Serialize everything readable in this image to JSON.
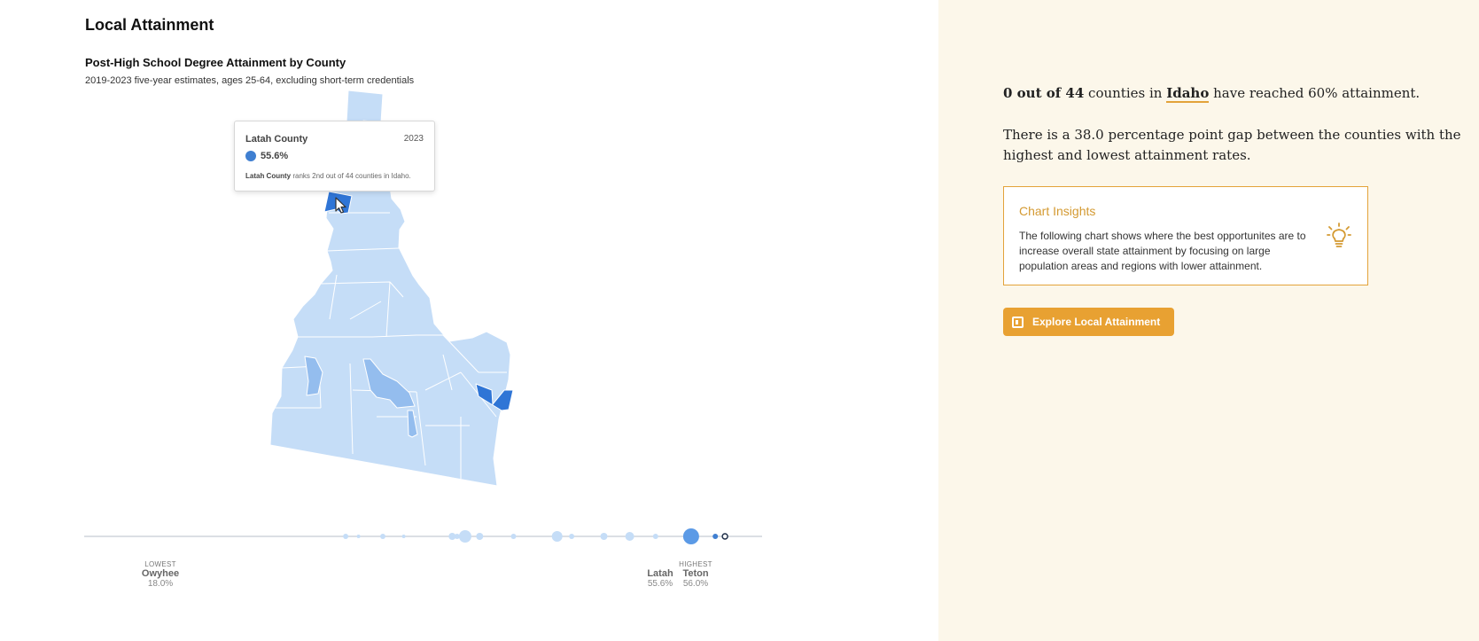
{
  "section_title": "Local Attainment",
  "chart": {
    "title": "Post-High School Degree Attainment by County",
    "subtitle": "2019-2023 five-year estimates, ages 25-64, excluding short-term credentials"
  },
  "tooltip": {
    "county": "Latah County",
    "year": "2023",
    "value": "55.6%",
    "rank_county": "Latah County",
    "rank_text": " ranks 2nd out of 44 counties in Idaho."
  },
  "colors": {
    "light": "#c5ddf7",
    "mid": "#94bdee",
    "dark": "#2f75d6",
    "accent": "#e8a132"
  },
  "chart_data": {
    "type": "strip",
    "xlim": [
      18.0,
      56.0
    ],
    "points": [
      {
        "v": 34.2,
        "r": 3
      },
      {
        "v": 35.0,
        "r": 2
      },
      {
        "v": 36.5,
        "r": 3
      },
      {
        "v": 37.8,
        "r": 2
      },
      {
        "v": 40.8,
        "r": 4
      },
      {
        "v": 41.1,
        "r": 3
      },
      {
        "v": 41.6,
        "r": 7
      },
      {
        "v": 42.5,
        "r": 4
      },
      {
        "v": 44.6,
        "r": 3
      },
      {
        "v": 47.3,
        "r": 6
      },
      {
        "v": 48.2,
        "r": 3
      },
      {
        "v": 50.2,
        "r": 4
      },
      {
        "v": 51.8,
        "r": 5
      },
      {
        "v": 53.4,
        "r": 3
      },
      {
        "v": 55.6,
        "r": 9
      },
      {
        "v": 57.1,
        "r": 3
      },
      {
        "v": 57.7,
        "r": 3
      }
    ],
    "lowest": {
      "tag": "LOWEST",
      "name": "Owyhee",
      "value": "18.0%"
    },
    "highest": {
      "tag": "HIGHEST",
      "name": "Teton",
      "value": "56.0%"
    },
    "selected": {
      "name": "Latah",
      "value": "55.6%"
    }
  },
  "summary": {
    "count": "0 out of 44",
    "mid": " counties in ",
    "state": "Idaho",
    "end": " have reached 60% attainment.",
    "gap_text": "There is a 38.0 percentage point gap between the counties with the highest and lowest attainment rates."
  },
  "insights": {
    "title": "Chart Insights",
    "text": "The following chart shows where the best opportunites are to increase overall state attainment by focusing on large population areas and regions with lower attainment."
  },
  "explore_button": {
    "label": "Explore Local Attainment"
  }
}
